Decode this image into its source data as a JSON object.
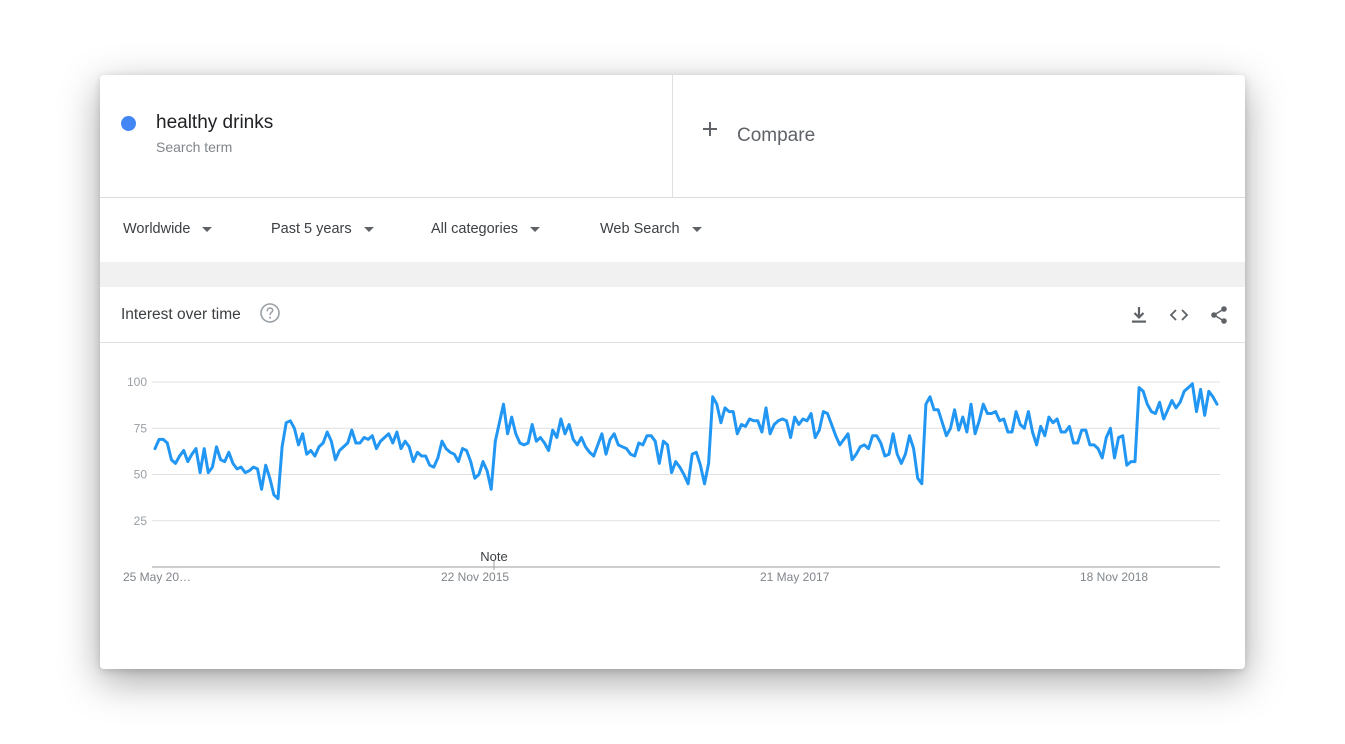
{
  "search_term": {
    "name": "healthy drinks",
    "type": "Search term",
    "color": "#4285f4"
  },
  "compare": {
    "label": "Compare"
  },
  "filters": {
    "region": "Worldwide",
    "period": "Past 5 years",
    "category": "All categories",
    "property": "Web Search"
  },
  "chart_header": {
    "title": "Interest over time"
  },
  "icons": {
    "help": "help-icon",
    "download": "download-icon",
    "embed": "embed-code-icon",
    "share": "share-icon"
  },
  "chart_data": {
    "type": "line",
    "title": "",
    "xlabel": "",
    "ylabel": "",
    "ylim": [
      0,
      100
    ],
    "y_ticks": [
      25,
      50,
      75,
      100
    ],
    "x_tick_labels": [
      "25 May 20…",
      "22 Nov 2015",
      "21 May 2017",
      "18 Nov 2018"
    ],
    "note_label": "Note",
    "grid": true,
    "line_color": "#2196f3",
    "series": [
      {
        "values": [
          64,
          69,
          69,
          67,
          58,
          56,
          60,
          63,
          57,
          61,
          64,
          51,
          64,
          51,
          54,
          65,
          58,
          57,
          62,
          56,
          53,
          54,
          51,
          52,
          54,
          53,
          42,
          55,
          48,
          39,
          37,
          65,
          78,
          79,
          75,
          66,
          72,
          61,
          63,
          60,
          65,
          67,
          73,
          68,
          58,
          63,
          65,
          67,
          74,
          67,
          67,
          70,
          69,
          71,
          64,
          68,
          70,
          72,
          67,
          73,
          64,
          68,
          65,
          57,
          62,
          60,
          60,
          55,
          54,
          59,
          68,
          64,
          62,
          61,
          57,
          64,
          63,
          57,
          48,
          50,
          57,
          52,
          42,
          68,
          78,
          88,
          72,
          81,
          72,
          67,
          66,
          67,
          77,
          68,
          70,
          67,
          63,
          74,
          70,
          80,
          72,
          77,
          69,
          66,
          70,
          65,
          62,
          60,
          66,
          72,
          61,
          69,
          72,
          66,
          65,
          64,
          61,
          60,
          67,
          66,
          71,
          71,
          68,
          56,
          68,
          66,
          51,
          57,
          54,
          50,
          45,
          61,
          62,
          55,
          45,
          56,
          92,
          88,
          78,
          86,
          84,
          84,
          72,
          77,
          76,
          80,
          79,
          79,
          73,
          86,
          72,
          77,
          79,
          80,
          79,
          70,
          81,
          77,
          80,
          79,
          83,
          70,
          74,
          84,
          83,
          77,
          71,
          66,
          69,
          72,
          58,
          61,
          65,
          66,
          64,
          71,
          71,
          67,
          60,
          61,
          72,
          61,
          56,
          61,
          71,
          64,
          48,
          45,
          88,
          92,
          85,
          85,
          78,
          71,
          75,
          85,
          74,
          81,
          73,
          88,
          72,
          79,
          88,
          83,
          83,
          84,
          79,
          80,
          73,
          73,
          84,
          77,
          75,
          84,
          73,
          66,
          76,
          71,
          81,
          78,
          80,
          73,
          73,
          76,
          67,
          67,
          74,
          74,
          66,
          66,
          64,
          59,
          70,
          75,
          59,
          70,
          71,
          55,
          57,
          57,
          97,
          95,
          88,
          84,
          83,
          89,
          80,
          85,
          90,
          86,
          89,
          95,
          97,
          99,
          84,
          96,
          82,
          95,
          92,
          88
        ]
      }
    ]
  }
}
